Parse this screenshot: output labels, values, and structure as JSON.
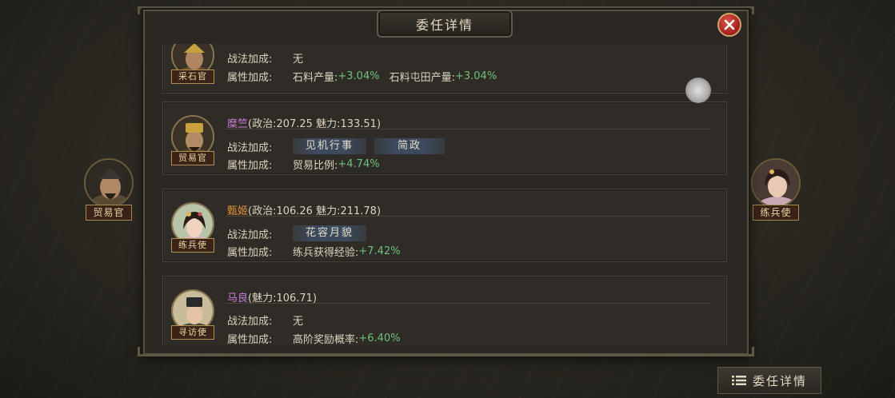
{
  "dialog": {
    "title": "委任详情"
  },
  "side_officers": {
    "left_tag": "贸易官",
    "right_tag": "练兵使"
  },
  "cards": [
    {
      "role": "采石官",
      "skill_label": "战法加成:",
      "skill_value": "无",
      "attr_label": "属性加成:",
      "attr_text_1": "石料产量:",
      "attr_value_1": "+3.04%",
      "attr_text_2": "石料屯田产量:",
      "attr_value_2": "+3.04%"
    },
    {
      "role": "贸易官",
      "name": "糜竺",
      "stats": "(政治:207.25 魅力:133.51)",
      "skill_label": "战法加成:",
      "skills": [
        "见机行事",
        "简政"
      ],
      "attr_label": "属性加成:",
      "attr_text_1": "贸易比例:",
      "attr_value_1": "+4.74%"
    },
    {
      "role": "练兵使",
      "name": "甄姬",
      "stats": "(政治:106.26 魅力:211.78)",
      "skill_label": "战法加成:",
      "skills": [
        "花容月貌"
      ],
      "attr_label": "属性加成:",
      "attr_text_1": "练兵获得经验:",
      "attr_value_1": "+7.42%"
    },
    {
      "role": "寻访使",
      "name": "马良",
      "stats": "(魅力:106.71)",
      "skill_label": "战法加成:",
      "skill_value": "无",
      "attr_label": "属性加成:",
      "attr_text_1": "高阶奖励概率:",
      "attr_value_1": "+6.40%"
    }
  ],
  "bottom_button": {
    "label": "委任详情"
  },
  "colors": {
    "name_purple": "#c87cd6",
    "name_orange": "#e4923a",
    "bonus_green": "#6fc07a",
    "close_red": "#c0332c"
  },
  "icons": {
    "close": "close-icon",
    "list": "list-icon"
  }
}
